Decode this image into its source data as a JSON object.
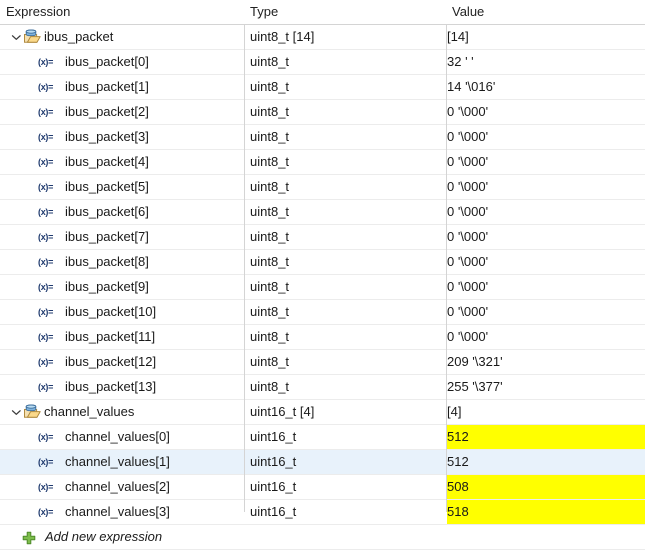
{
  "view": {
    "name": "Expressions",
    "selection_color": "#e8f2fb",
    "changed_value_color": "#ffff00",
    "grid_line_color": "#d4d4d4"
  },
  "columns": {
    "expression": "Expression",
    "type": "Type",
    "value": "Value"
  },
  "rows": [
    {
      "expression": "ibus_packet",
      "type": "uint8_t [14]",
      "value": "[14]",
      "level": 0,
      "icon": "folder-open-icon",
      "chevron": "chevron-down-icon",
      "expanded": true,
      "selected": false,
      "changed": false
    },
    {
      "expression": "ibus_packet[0]",
      "type": "uint8_t",
      "value": "32 ' '",
      "level": 1,
      "icon": "variable-icon",
      "selected": false,
      "changed": false
    },
    {
      "expression": "ibus_packet[1]",
      "type": "uint8_t",
      "value": "14 '\\016'",
      "level": 1,
      "icon": "variable-icon",
      "selected": false,
      "changed": false
    },
    {
      "expression": "ibus_packet[2]",
      "type": "uint8_t",
      "value": "0 '\\000'",
      "level": 1,
      "icon": "variable-icon",
      "selected": false,
      "changed": false
    },
    {
      "expression": "ibus_packet[3]",
      "type": "uint8_t",
      "value": "0 '\\000'",
      "level": 1,
      "icon": "variable-icon",
      "selected": false,
      "changed": false
    },
    {
      "expression": "ibus_packet[4]",
      "type": "uint8_t",
      "value": "0 '\\000'",
      "level": 1,
      "icon": "variable-icon",
      "selected": false,
      "changed": false
    },
    {
      "expression": "ibus_packet[5]",
      "type": "uint8_t",
      "value": "0 '\\000'",
      "level": 1,
      "icon": "variable-icon",
      "selected": false,
      "changed": false
    },
    {
      "expression": "ibus_packet[6]",
      "type": "uint8_t",
      "value": "0 '\\000'",
      "level": 1,
      "icon": "variable-icon",
      "selected": false,
      "changed": false
    },
    {
      "expression": "ibus_packet[7]",
      "type": "uint8_t",
      "value": "0 '\\000'",
      "level": 1,
      "icon": "variable-icon",
      "selected": false,
      "changed": false
    },
    {
      "expression": "ibus_packet[8]",
      "type": "uint8_t",
      "value": "0 '\\000'",
      "level": 1,
      "icon": "variable-icon",
      "selected": false,
      "changed": false
    },
    {
      "expression": "ibus_packet[9]",
      "type": "uint8_t",
      "value": "0 '\\000'",
      "level": 1,
      "icon": "variable-icon",
      "selected": false,
      "changed": false
    },
    {
      "expression": "ibus_packet[10]",
      "type": "uint8_t",
      "value": "0 '\\000'",
      "level": 1,
      "icon": "variable-icon",
      "selected": false,
      "changed": false
    },
    {
      "expression": "ibus_packet[11]",
      "type": "uint8_t",
      "value": "0 '\\000'",
      "level": 1,
      "icon": "variable-icon",
      "selected": false,
      "changed": false
    },
    {
      "expression": "ibus_packet[12]",
      "type": "uint8_t",
      "value": "209 '\\321'",
      "level": 1,
      "icon": "variable-icon",
      "selected": false,
      "changed": false
    },
    {
      "expression": "ibus_packet[13]",
      "type": "uint8_t",
      "value": "255 '\\377'",
      "level": 1,
      "icon": "variable-icon",
      "selected": false,
      "changed": false
    },
    {
      "expression": "channel_values",
      "type": "uint16_t [4]",
      "value": "[4]",
      "level": 0,
      "icon": "folder-open-icon",
      "chevron": "chevron-down-icon",
      "expanded": true,
      "selected": false,
      "changed": false
    },
    {
      "expression": "channel_values[0]",
      "type": "uint16_t",
      "value": "512",
      "level": 1,
      "icon": "variable-icon",
      "selected": false,
      "changed": true
    },
    {
      "expression": "channel_values[1]",
      "type": "uint16_t",
      "value": "512",
      "level": 1,
      "icon": "variable-icon",
      "selected": true,
      "changed": false
    },
    {
      "expression": "channel_values[2]",
      "type": "uint16_t",
      "value": "508",
      "level": 1,
      "icon": "variable-icon",
      "selected": false,
      "changed": true
    },
    {
      "expression": "channel_values[3]",
      "type": "uint16_t",
      "value": "518",
      "level": 1,
      "icon": "variable-icon",
      "selected": false,
      "changed": true
    }
  ],
  "add_new_row": {
    "label": "Add new expression",
    "icon": "plus-icon",
    "type": "",
    "value": ""
  }
}
